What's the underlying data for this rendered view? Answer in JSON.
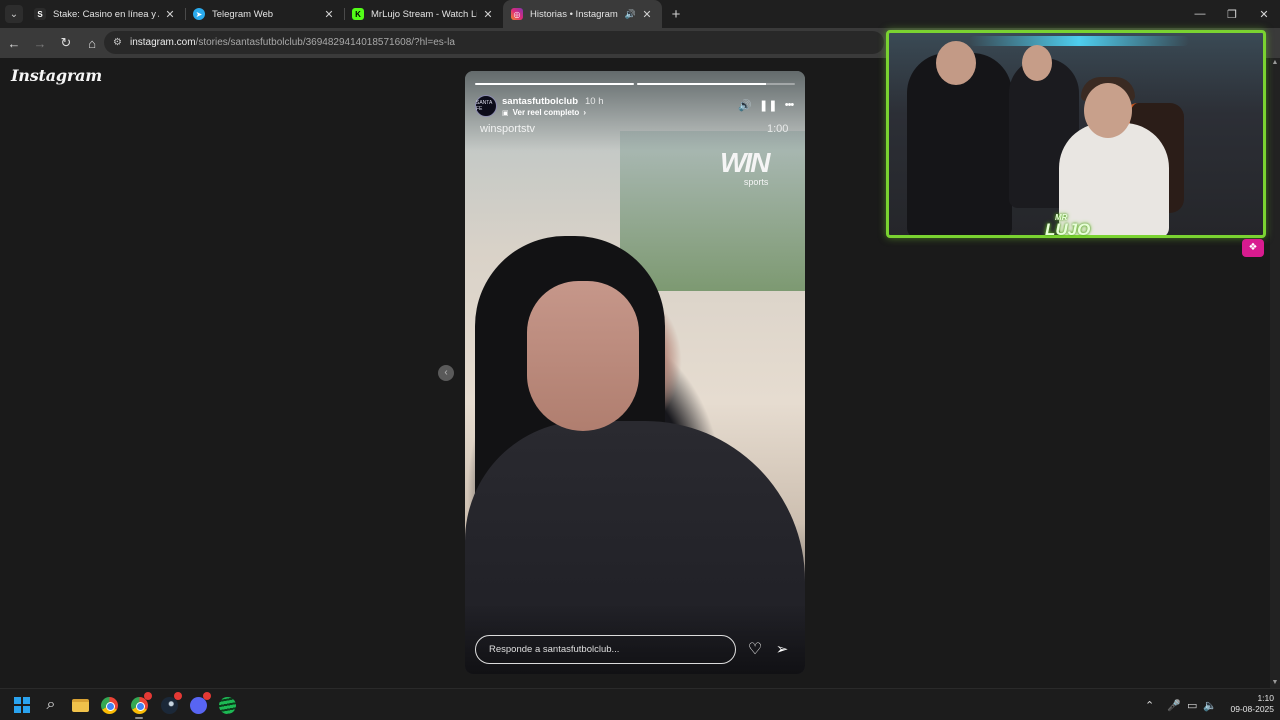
{
  "browser": {
    "tabs": [
      {
        "title": "Stake: Casino en línea y Apuesta",
        "favicon": "stake-icon",
        "favicon_glyph": "S",
        "favicon_color": "#2b2b2b",
        "active": false
      },
      {
        "title": "Telegram Web",
        "favicon": "telegram-icon",
        "favicon_glyph": "➤",
        "favicon_color": "#2aabee",
        "active": false
      },
      {
        "title": "MrLujo Stream - Watch Live on",
        "favicon": "kick-icon",
        "favicon_glyph": "K",
        "favicon_color": "#53fc18",
        "active": false
      },
      {
        "title": "Historias • Instagram",
        "favicon": "instagram-icon",
        "favicon_glyph": "◎",
        "favicon_color": "#dd2a7b",
        "active": true,
        "audio": true
      }
    ],
    "address": {
      "host": "instagram.com",
      "path": "/stories/santasfutbolclub/3694829414018571608/?hl=es-la"
    },
    "icons": {
      "tab_menu": "chevron-down-icon",
      "back": "←",
      "forward": "→",
      "reload": "↻",
      "home": "⌂",
      "site_info": "⚙",
      "new_tab": "+",
      "minimize": "—",
      "restore": "❐",
      "close": "✕",
      "tab_close": "✕",
      "tab_audio": "🔊"
    }
  },
  "page": {
    "logo": "Instagram",
    "prev_arrow": "‹",
    "scroll_up": "▲",
    "scroll_down": "▼"
  },
  "story": {
    "username": "santasfutbolclub",
    "time_ago": "10 h",
    "reel_link": "Ver reel completo",
    "reel_chevron": "›",
    "reel_icon": "▣",
    "overlay_text": "winsportstv",
    "video_time": "1:00",
    "watermark": "WIN",
    "watermark_sub": "sports",
    "avatar_text": "SANTA FE",
    "progress": [
      1.0,
      0.82
    ],
    "controls": {
      "sound": "🔊",
      "pause": "❚❚",
      "more": "•••"
    },
    "reply_placeholder": "Responde a santasfutbolclub...",
    "heart": "♡",
    "send": "➢"
  },
  "pip": {
    "logo": "LUJO",
    "logo_sub": "MR",
    "accent": "#7ad331",
    "ext_icon": "❖"
  },
  "taskbar": {
    "search_icon": "⌕",
    "tray_up": "⌃",
    "tray_mic": "🎤",
    "tray_net": "▭",
    "tray_vol": "🔈",
    "time": "1:10",
    "date": "09-08-2025"
  }
}
